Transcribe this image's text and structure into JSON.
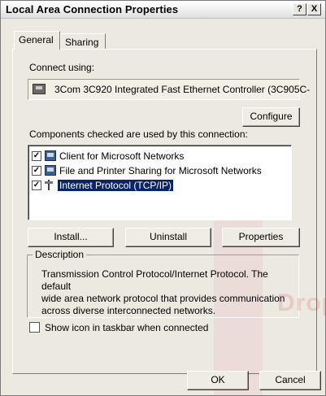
{
  "window": {
    "title": "Local Area Connection Properties",
    "help_label": "?",
    "close_label": "X"
  },
  "tabs": [
    {
      "label": "General",
      "active": true
    },
    {
      "label": "Sharing",
      "active": false
    }
  ],
  "connect": {
    "label": "Connect using:",
    "adapter": "3Com 3C920 Integrated Fast Ethernet Controller (3C905C-",
    "adapter_icon": "network-card-icon",
    "configure_label": "Configure"
  },
  "components": {
    "label": "Components checked are used by this connection:",
    "items": [
      {
        "label": "Client for Microsoft Networks",
        "checked": true,
        "icon": "network-client-icon",
        "selected": false
      },
      {
        "label": "File and Printer Sharing for Microsoft Networks",
        "checked": true,
        "icon": "network-service-icon",
        "selected": false
      },
      {
        "label": "Internet Protocol (TCP/IP)",
        "checked": true,
        "icon": "protocol-icon",
        "selected": true
      }
    ],
    "install_label": "Install...",
    "uninstall_label": "Uninstall",
    "properties_label": "Properties"
  },
  "description": {
    "title": "Description",
    "lines": [
      "Transmission Control Protocol/Internet Protocol. The default",
      "wide area network protocol that provides communication",
      "across diverse interconnected networks."
    ]
  },
  "taskbar": {
    "label": "Show icon in taskbar when connected",
    "checked": false
  },
  "footer": {
    "ok_label": "OK",
    "cancel_label": "Cancel"
  },
  "watermark": {
    "text": "Dropp"
  },
  "colors": {
    "selection": "#0a246a",
    "dialog_face": "#ece9e1"
  }
}
